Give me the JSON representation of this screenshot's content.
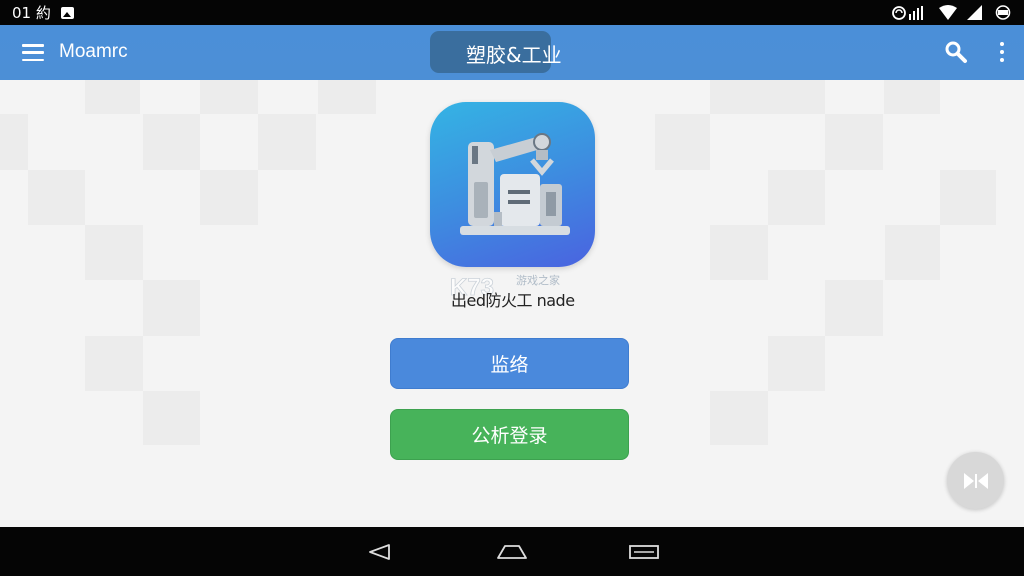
{
  "status_bar": {
    "left_text": "01 約",
    "right_icons": [
      "signal-icon",
      "wifi-icon",
      "cell-signal-icon",
      "battery-icon"
    ]
  },
  "app_bar": {
    "app_name": "Moamrc",
    "title": "塑胶&工业",
    "icons": [
      "menu-icon",
      "search-icon",
      "more-vert-icon"
    ]
  },
  "app": {
    "caption": "出ed防火工 nade",
    "icon": "robot-arm-icon",
    "watermark": "K73 游戏之家"
  },
  "buttons": {
    "primary_label": "监络",
    "login_label": "公析登录"
  },
  "fab": {
    "icon": "collapse-icon"
  },
  "nav_bar": {
    "icons": [
      "back-icon",
      "home-icon",
      "recent-apps-icon"
    ]
  },
  "colors": {
    "app_bar": "#4b8fd8",
    "primary_button": "#4a89dc",
    "login_button": "#47b35a",
    "status_bar": "#050505"
  }
}
